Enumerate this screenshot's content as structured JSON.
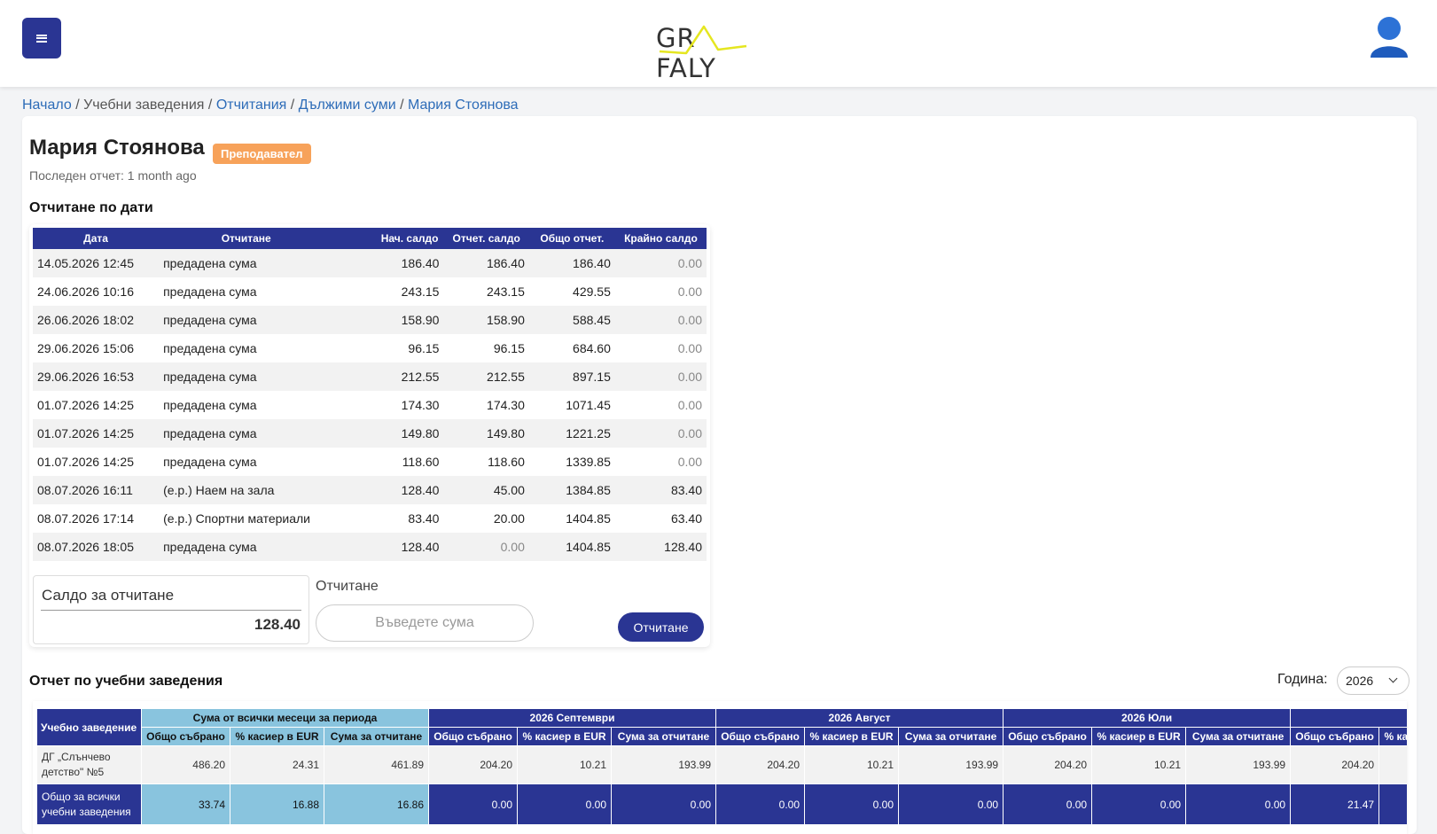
{
  "header": {
    "logo_left": "GR",
    "logo_right": "FALY",
    "brand_color": "#2a3593"
  },
  "breadcrumb": [
    "Начало",
    "Учебни заведения",
    "Отчитания",
    "Дължими суми",
    "Мария Стоянова"
  ],
  "person": {
    "name": "Мария Стоянова",
    "role": "Преподавател",
    "last_report": "Последен отчет: 1 month ago"
  },
  "dates_section": {
    "title": "Отчитане по дати",
    "headers": [
      "Дата",
      "Отчитане",
      "Нач. салдо",
      "Отчет. салдо",
      "Общо отчет.",
      "Крайно салдо"
    ],
    "rows": [
      [
        "14.05.2026 12:45",
        "предадена сума",
        "186.40",
        "186.40",
        "186.40",
        "0.00"
      ],
      [
        "24.06.2026 10:16",
        "предадена сума",
        "243.15",
        "243.15",
        "429.55",
        "0.00"
      ],
      [
        "26.06.2026 18:02",
        "предадена сума",
        "158.90",
        "158.90",
        "588.45",
        "0.00"
      ],
      [
        "29.06.2026 15:06",
        "предадена сума",
        "96.15",
        "96.15",
        "684.60",
        "0.00"
      ],
      [
        "29.06.2026 16:53",
        "предадена сума",
        "212.55",
        "212.55",
        "897.15",
        "0.00"
      ],
      [
        "01.07.2026 14:25",
        "предадена сума",
        "174.30",
        "174.30",
        "1071.45",
        "0.00"
      ],
      [
        "01.07.2026 14:25",
        "предадена сума",
        "149.80",
        "149.80",
        "1221.25",
        "0.00"
      ],
      [
        "01.07.2026 14:25",
        "предадена сума",
        "118.60",
        "118.60",
        "1339.85",
        "0.00"
      ],
      [
        "08.07.2026 16:11",
        "(е.р.) Наем на зала",
        "128.40",
        "45.00",
        "1384.85",
        "83.40"
      ],
      [
        "08.07.2026 17:14",
        "(е.р.) Спортни материали",
        "83.40",
        "20.00",
        "1404.85",
        "63.40"
      ],
      [
        "08.07.2026 18:05",
        "предадена сума",
        "128.40",
        "0.00",
        "1404.85",
        "128.40"
      ]
    ],
    "balance_label": "Салдо за отчитане",
    "balance_value": "128.40",
    "report_label": "Отчитане",
    "amount_placeholder": "Въведете сума",
    "report_button": "Отчитане"
  },
  "schools_section": {
    "title": "Отчет по учебни заведения",
    "year_label": "Година:",
    "year_value": "2026",
    "school_header": "Учебно заведение",
    "groups": [
      "Сума от всички месеци за периода",
      "2026 Септември",
      "2026 Август",
      "2026 Юли",
      ""
    ],
    "subheaders": [
      "Общо събрано",
      "% касиер в EUR",
      "Сума за отчитане"
    ],
    "school_row": {
      "name": "ДГ „Слънчево детство\" №5",
      "values": [
        "486.20",
        "24.31",
        "461.89",
        "204.20",
        "10.21",
        "193.99",
        "204.20",
        "10.21",
        "193.99",
        "204.20",
        "10.21",
        "193.99",
        "204.20"
      ]
    },
    "total_row": {
      "name": "Общо за всички учебни заведения",
      "values": [
        "33.74",
        "16.88",
        "16.86",
        "0.00",
        "0.00",
        "0.00",
        "0.00",
        "0.00",
        "0.00",
        "0.00",
        "0.00",
        "0.00",
        "21.47"
      ]
    }
  }
}
